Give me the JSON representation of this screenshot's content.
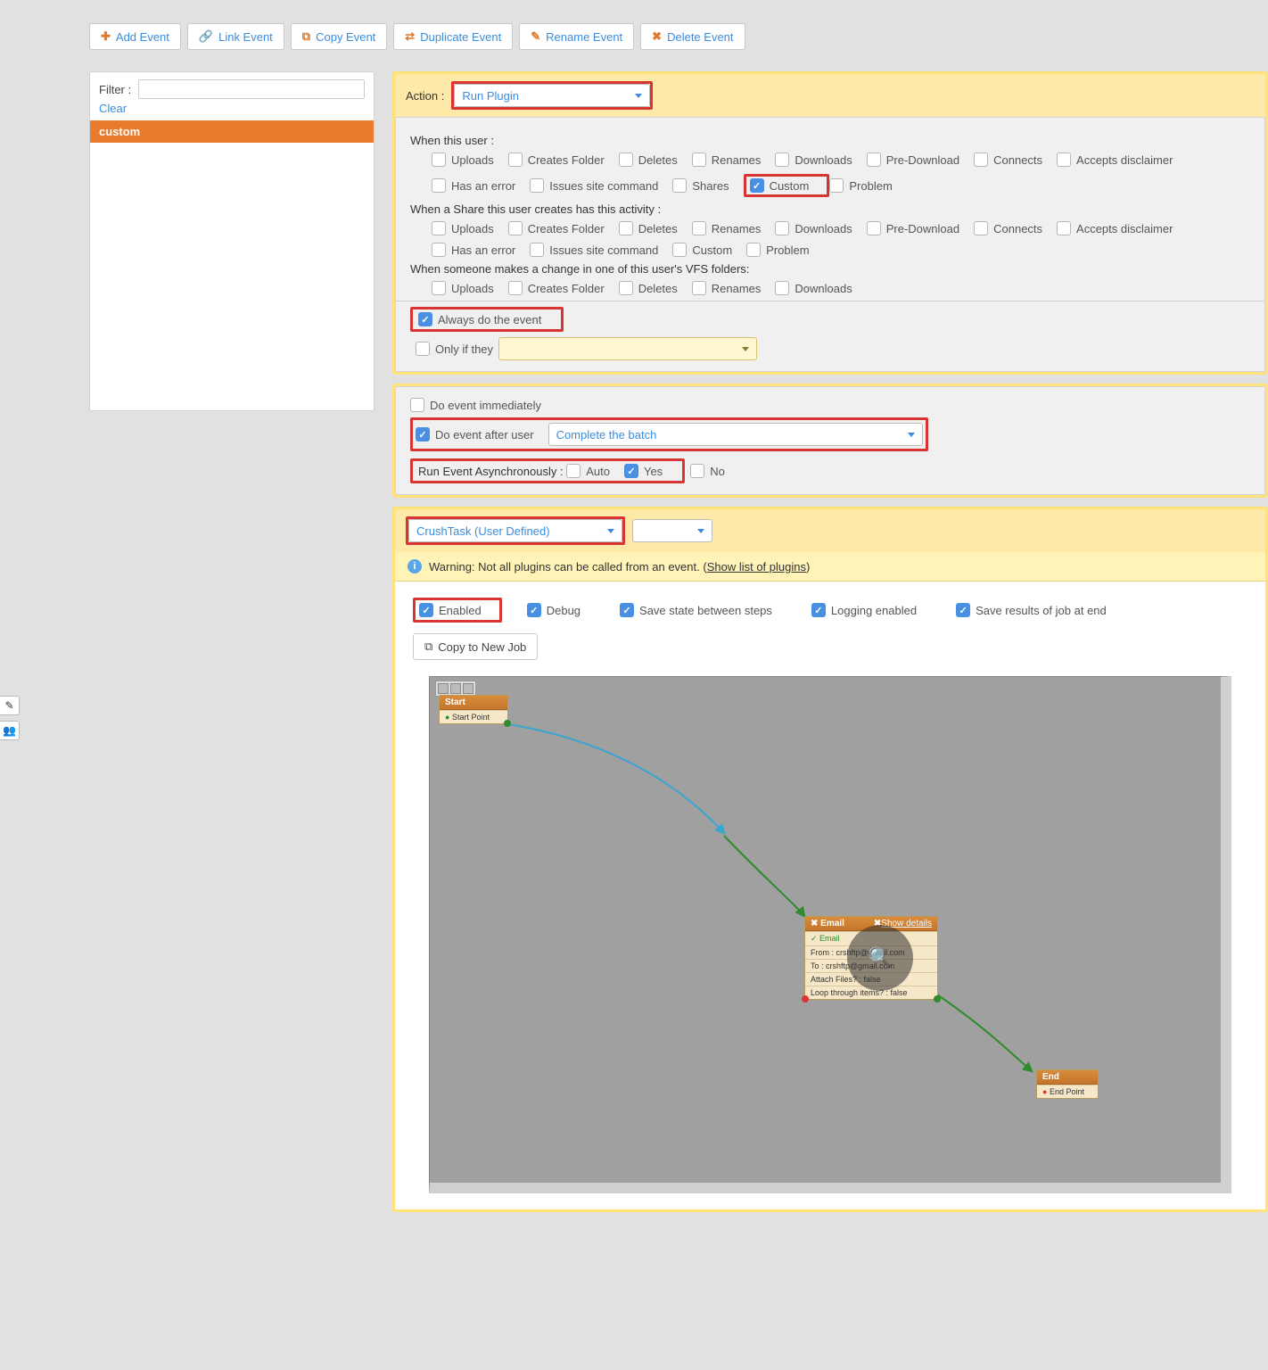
{
  "toolbar": {
    "add": "Add Event",
    "link": "Link Event",
    "copy": "Copy Event",
    "dup": "Duplicate Event",
    "rename": "Rename Event",
    "del": "Delete Event"
  },
  "sidebar": {
    "filter_label": "Filter :",
    "clear": "Clear",
    "items": [
      "custom"
    ]
  },
  "action": {
    "label": "Action :",
    "value": "Run Plugin"
  },
  "triggers": {
    "user_label": "When this user :",
    "user": [
      "Uploads",
      "Creates Folder",
      "Deletes",
      "Renames",
      "Downloads",
      "Pre-Download",
      "Connects",
      "Accepts disclaimer",
      "Has an error",
      "Issues site command",
      "Shares",
      "Custom",
      "Problem"
    ],
    "share_label": "When a Share this user creates has this activity :",
    "share": [
      "Uploads",
      "Creates Folder",
      "Deletes",
      "Renames",
      "Downloads",
      "Pre-Download",
      "Connects",
      "Accepts disclaimer",
      "Has an error",
      "Issues site command",
      "Custom",
      "Problem"
    ],
    "vfs_label": "When someone makes a change in one of this user's VFS folders:",
    "vfs": [
      "Uploads",
      "Creates Folder",
      "Deletes",
      "Renames",
      "Downloads"
    ],
    "always": "Always do the event",
    "onlyif": "Only if they"
  },
  "timing": {
    "immediate": "Do event immediately",
    "after": "Do event after user",
    "after_value": "Complete the batch",
    "async_label": "Run Event Asynchronously :",
    "auto": "Auto",
    "yes": "Yes",
    "no": "No"
  },
  "plugin": {
    "name": "CrushTask (User Defined)",
    "warn": "Warning: Not all plugins can be called from an event. (",
    "warn_link": "Show list of plugins",
    "warn_close": ")",
    "opts": {
      "enabled": "Enabled",
      "debug": "Debug",
      "save_state": "Save state between steps",
      "logging": "Logging enabled",
      "save_results": "Save results of job at end",
      "copy_job": "Copy to New Job"
    }
  },
  "flow": {
    "start": {
      "title": "Start",
      "sub": "Start Point"
    },
    "email": {
      "title": "Email",
      "link": "Show details",
      "from": "From : crshftp@gmail.com",
      "to": "To : crshftp@gmail.com",
      "attach": "Attach Files? : false",
      "loop": "Loop through items? : false"
    },
    "end": {
      "title": "End",
      "sub": "End Point"
    }
  }
}
